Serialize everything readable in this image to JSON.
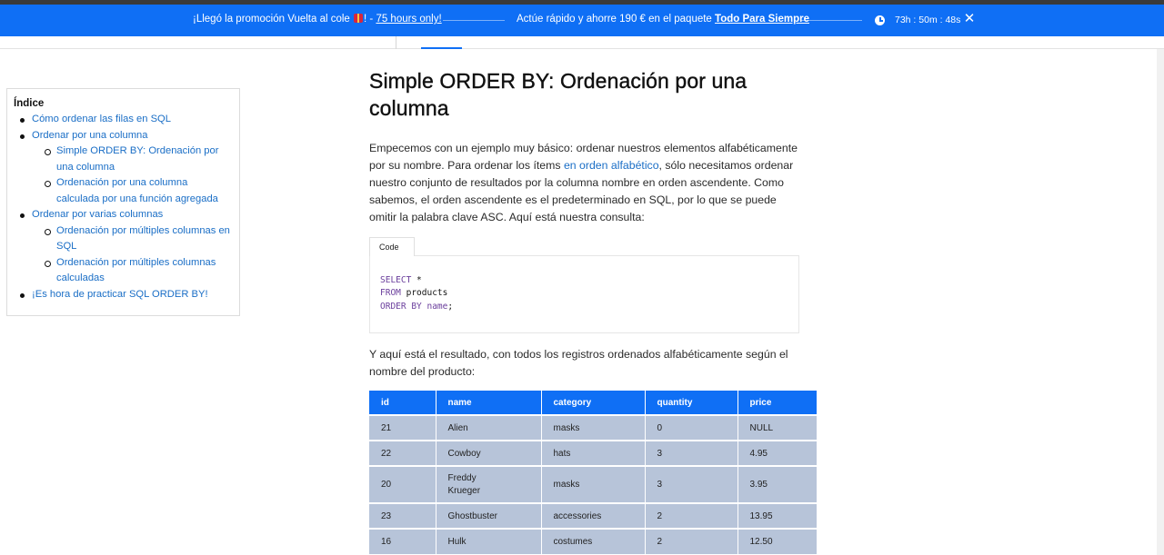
{
  "promo": {
    "text_pre": "¡Llegó la promoción Vuelta al cole ",
    "text_mid": "! - ",
    "hours": "75 hours only!",
    "text2_pre": "Actúe rápido y ahorre 190 € en el paquete ",
    "package": "Todo Para Siempre",
    "timer": "73h : 50m : 48s",
    "close_glyph": "✕",
    "bg_color": "#0f6ff5"
  },
  "toc": {
    "title": "Índice",
    "items": [
      {
        "label": "Cómo ordenar las filas en SQL"
      },
      {
        "label": "Ordenar por una columna"
      },
      {
        "label": "Simple ORDER BY: Ordenación por una columna"
      },
      {
        "label": "Ordenación por una columna calculada por una función agregada"
      },
      {
        "label": "Ordenar por varias columnas"
      },
      {
        "label": "Ordenación por múltiples columnas en SQL"
      },
      {
        "label": "Ordenación por múltiples columnas calculadas"
      },
      {
        "label": "¡Es hora de practicar SQL ORDER BY!"
      }
    ]
  },
  "article": {
    "heading": "Simple ORDER BY: Ordenación por una columna",
    "intro_before": "Empecemos con un ejemplo muy básico: ordenar nuestros elementos alfabéticamente por su nombre. Para ordenar los ítems ",
    "intro_link": "en orden alfabético",
    "intro_after": ", sólo necesitamos ordenar nuestro conjunto de resultados por la columna nombre en orden ascendente. Como sabemos, el orden ascendente es el predeterminado en SQL, por lo que se puede omitir la palabra clave ASC. Aquí está nuestra consulta:",
    "code_tab": "Code",
    "code": {
      "l1_kw": "SELECT",
      "l1_rest": " *",
      "l2_kw": "FROM",
      "l2_rest": " products",
      "l3_kw": "ORDER BY",
      "l3_col": " name",
      "l3_rest": ";"
    },
    "result_text": "Y aquí está el resultado, con todos los registros ordenados alfabéticamente según el nombre del producto:"
  },
  "table": {
    "headers": [
      "id",
      "name",
      "category",
      "quantity",
      "price"
    ],
    "rows": [
      [
        "21",
        "Alien",
        "masks",
        "0",
        "NULL"
      ],
      [
        "22",
        "Cowboy",
        "hats",
        "3",
        "4.95"
      ],
      [
        "20",
        "Freddy Krueger",
        "masks",
        "3",
        "3.95"
      ],
      [
        "23",
        "Ghostbuster",
        "accessories",
        "2",
        "13.95"
      ],
      [
        "16",
        "Hulk",
        "costumes",
        "2",
        "12.50"
      ]
    ]
  }
}
